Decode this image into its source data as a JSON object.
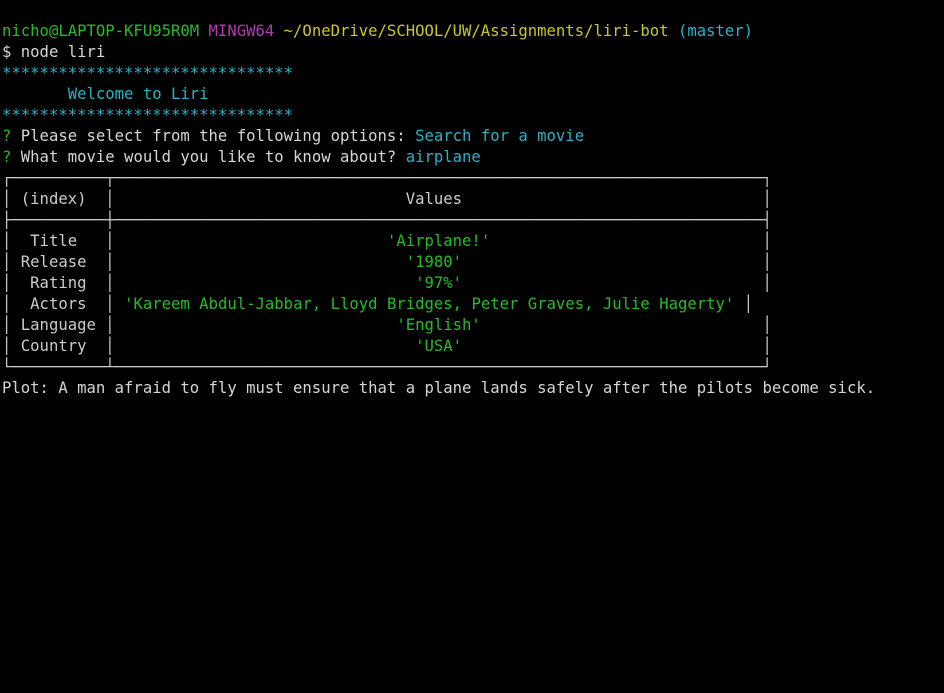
{
  "prompt": {
    "user": "nicho@LAPTOP-KFU95R0M",
    "system": "MINGW64",
    "path": "~/OneDrive/SCHOOL/UW/Assignments/liri-bot",
    "branch": "(master)",
    "symbol": "$",
    "command": "node liri"
  },
  "banner": {
    "stars": "*******************************",
    "welcome": "Welcome to Liri"
  },
  "questions": [
    {
      "marker": "?",
      "text": "Please select from the following options:",
      "answer": "Search for a movie"
    },
    {
      "marker": "?",
      "text": "What movie would you like to know about?",
      "answer": "airplane"
    }
  ],
  "table": {
    "headers": {
      "index": "(index)",
      "values": "Values"
    },
    "rows": [
      {
        "key": "Title",
        "value": "'Airplane!'"
      },
      {
        "key": "Release",
        "value": "'1980'"
      },
      {
        "key": "Rating",
        "value": "'97%'"
      },
      {
        "key": "Actors",
        "value": "'Kareem Abdul-Jabbar, Lloyd Bridges, Peter Graves, Julie Hagerty'"
      },
      {
        "key": "Language",
        "value": "'English'"
      },
      {
        "key": "Country",
        "value": "'USA'"
      }
    ]
  },
  "plot": "Plot: A man afraid to fly must ensure that a plane lands safely after the pilots become sick."
}
